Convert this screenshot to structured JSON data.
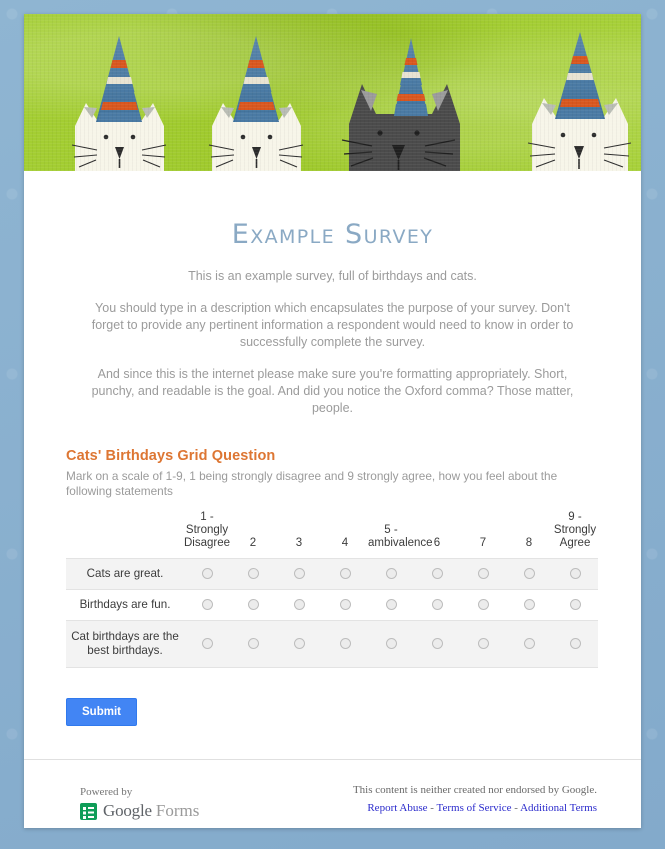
{
  "banner": {
    "alt": "party-cats-banner",
    "bg_color": "#9ecb2b",
    "cats": [
      {
        "name": "white-cat-1",
        "body": "#f6f4e8",
        "hat_top": "#4d7fa8"
      },
      {
        "name": "white-cat-2",
        "body": "#f6f4e8",
        "hat_top": "#4d7fa8"
      },
      {
        "name": "gray-cat",
        "body": "#4a4a4a",
        "hat_top": "#4d7fa8"
      },
      {
        "name": "white-cat-3",
        "body": "#f6f4e8",
        "hat_top": "#4d7fa8"
      }
    ]
  },
  "form": {
    "title": "Example Survey",
    "description_lines": [
      "This is an example survey, full of birthdays and cats.",
      "You should type in a description which encapsulates the purpose of your survey. Don't forget to provide any pertinent information a respondent would need to know in order to successfully complete the survey.",
      "And since this is the internet please make sure you're formatting appropriately. Short, punchy, and readable is the goal. And did you notice the Oxford comma? Those matter, people."
    ],
    "title_color": "#8aa9c4"
  },
  "question": {
    "title": "Cats' Birthdays Grid Question",
    "title_color": "#dd7633",
    "help_text": "Mark on a scale of 1-9, 1 being strongly disagree and 9 strongly agree, how you feel about the following statements",
    "columns": [
      "1 - Strongly Disagree",
      "2",
      "3",
      "4",
      "5 - ambivalence",
      "6",
      "7",
      "8",
      "9 - Strongly Agree"
    ],
    "rows": [
      {
        "label": "Cats are great.",
        "selected": null
      },
      {
        "label": "Birthdays are fun.",
        "selected": null
      },
      {
        "label": "Cat birthdays are the best birthdays.",
        "selected": null
      }
    ]
  },
  "actions": {
    "submit_label": "Submit",
    "submit_color": "#4285f4"
  },
  "footer": {
    "powered_by": "Powered by",
    "brand_google": "Google",
    "brand_forms": "Forms",
    "disclaimer": "This content is neither created nor endorsed by Google.",
    "links": [
      {
        "label": "Report Abuse"
      },
      {
        "label": "Terms of Service"
      },
      {
        "label": "Additional Terms"
      }
    ],
    "link_separator": "-",
    "link_color": "#2b2bcc"
  }
}
